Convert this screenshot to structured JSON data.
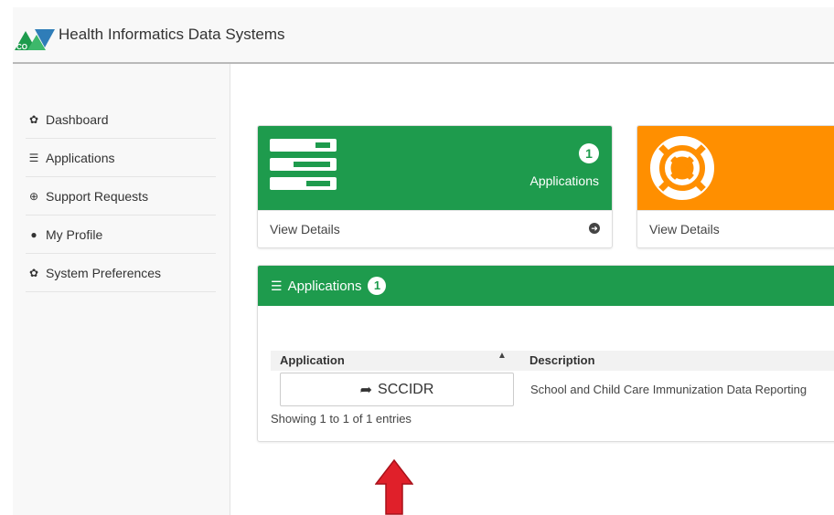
{
  "header": {
    "brand": "Health Informatics Data Systems",
    "logo_text": "CO"
  },
  "sidebar": {
    "items": [
      {
        "label": "Dashboard",
        "icon": "gear-icon"
      },
      {
        "label": "Applications",
        "icon": "list-icon"
      },
      {
        "label": "Support Requests",
        "icon": "lifebuoy-icon"
      },
      {
        "label": "My Profile",
        "icon": "user-icon"
      },
      {
        "label": "System Preferences",
        "icon": "gears-icon"
      }
    ]
  },
  "cards": {
    "applications": {
      "count": "1",
      "label": "Applications",
      "footer": "View Details",
      "color": "#1e9b4d"
    },
    "support": {
      "footer": "View Details",
      "color": "#ff8f00"
    }
  },
  "panel": {
    "title": "Applications",
    "count": "1",
    "columns": {
      "application": "Application",
      "description": "Description"
    },
    "rows": [
      {
        "application": "SCCIDR",
        "description": "School and Child Care Immunization Data Reporting"
      }
    ],
    "info": "Showing 1 to 1 of 1 entries"
  },
  "colors": {
    "accent_green": "#1e9b4d",
    "accent_orange": "#ff8f00",
    "annotation_red": "#e0202a"
  }
}
